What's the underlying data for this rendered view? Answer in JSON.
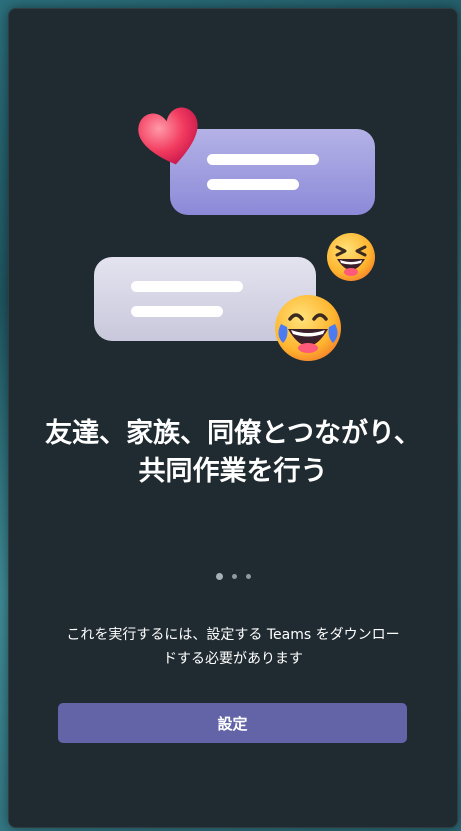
{
  "onboarding": {
    "headline_line1": "友達、家族、同僚とつながり、",
    "headline_line2": "共同作業を行う",
    "pager": {
      "current": 1,
      "total": 3
    },
    "description_line1": "これを実行するには、設定する Teams をダウンロー",
    "description_line2": "ドする必要があります",
    "setup_button_label": "設定"
  },
  "colors": {
    "panel": "#202b31",
    "button": "#6264a7",
    "bubble_purple": "#9d9be0",
    "bubble_grey": "#d6d5e6"
  },
  "icons": [
    "heart-icon",
    "laughing-squint-emoji",
    "laughing-tears-emoji"
  ]
}
